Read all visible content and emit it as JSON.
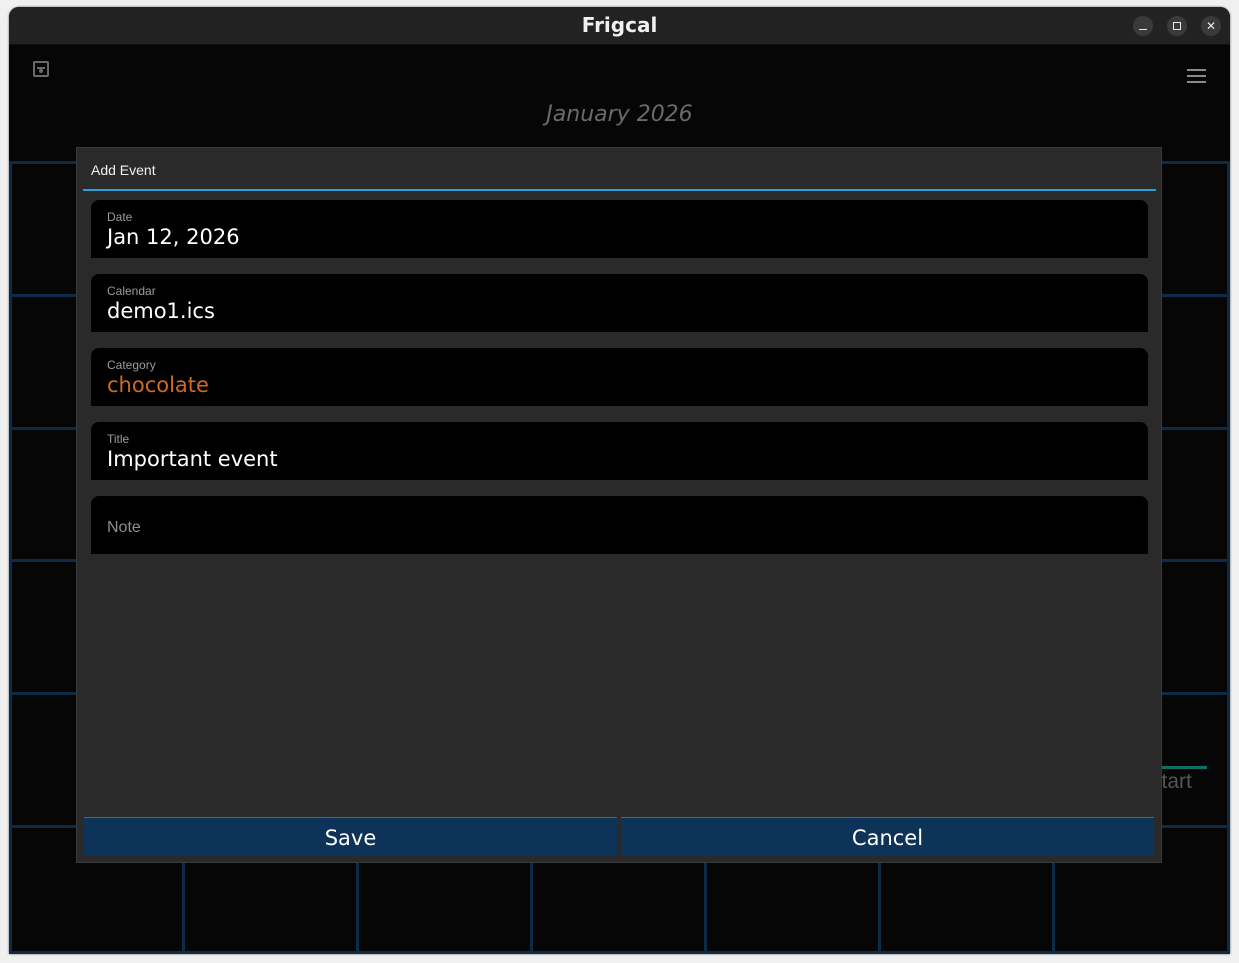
{
  "window": {
    "title": "Frigcal"
  },
  "toolbar": {
    "save_icon": "save-icon",
    "menu_icon": "hamburger-menu-icon"
  },
  "calendar": {
    "month_title": "January 2026",
    "partial_label": "start"
  },
  "dialog": {
    "title": "Add Event",
    "fields": {
      "date": {
        "label": "Date",
        "value": "Jan 12, 2026"
      },
      "calendar": {
        "label": "Calendar",
        "value": "demo1.ics"
      },
      "category": {
        "label": "Category",
        "value": "chocolate",
        "color": "#d2691e"
      },
      "title": {
        "label": "Title",
        "value": "Important event"
      },
      "note": {
        "placeholder": "Note",
        "value": ""
      }
    },
    "buttons": {
      "save": "Save",
      "cancel": "Cancel"
    }
  },
  "colors": {
    "accent": "#2e9fd6",
    "button_bg": "#0e3358",
    "grid": "#0d2a47"
  }
}
